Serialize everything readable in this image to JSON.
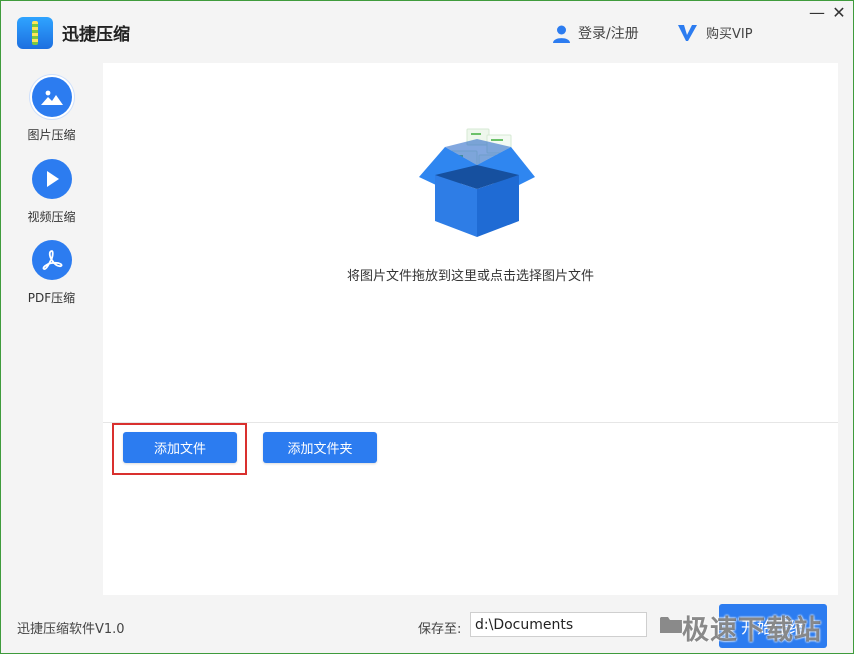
{
  "titlebar": {
    "app_title": "迅捷压缩",
    "login_label": "登录/注册",
    "vip_label": "购买VIP",
    "minimize": "—",
    "close": "✕"
  },
  "sidebar": {
    "items": [
      {
        "label": "图片压缩",
        "icon": "image-icon",
        "active": true
      },
      {
        "label": "视频压缩",
        "icon": "play-icon",
        "active": false
      },
      {
        "label": "PDF压缩",
        "icon": "pdf-icon",
        "active": false
      }
    ]
  },
  "main": {
    "drop_hint": "将图片文件拖放到这里或点击选择图片文件",
    "add_file_label": "添加文件",
    "add_folder_label": "添加文件夹"
  },
  "bottom": {
    "version": "迅捷压缩软件V1.0",
    "save_label": "保存至:",
    "save_path": "d:\\Documents",
    "start_label": "开始压缩"
  },
  "watermark": "极速下载站",
  "colors": {
    "accent": "#2c7cf0",
    "highlight_border": "#d9302e",
    "window_border": "#3f9b3c"
  }
}
